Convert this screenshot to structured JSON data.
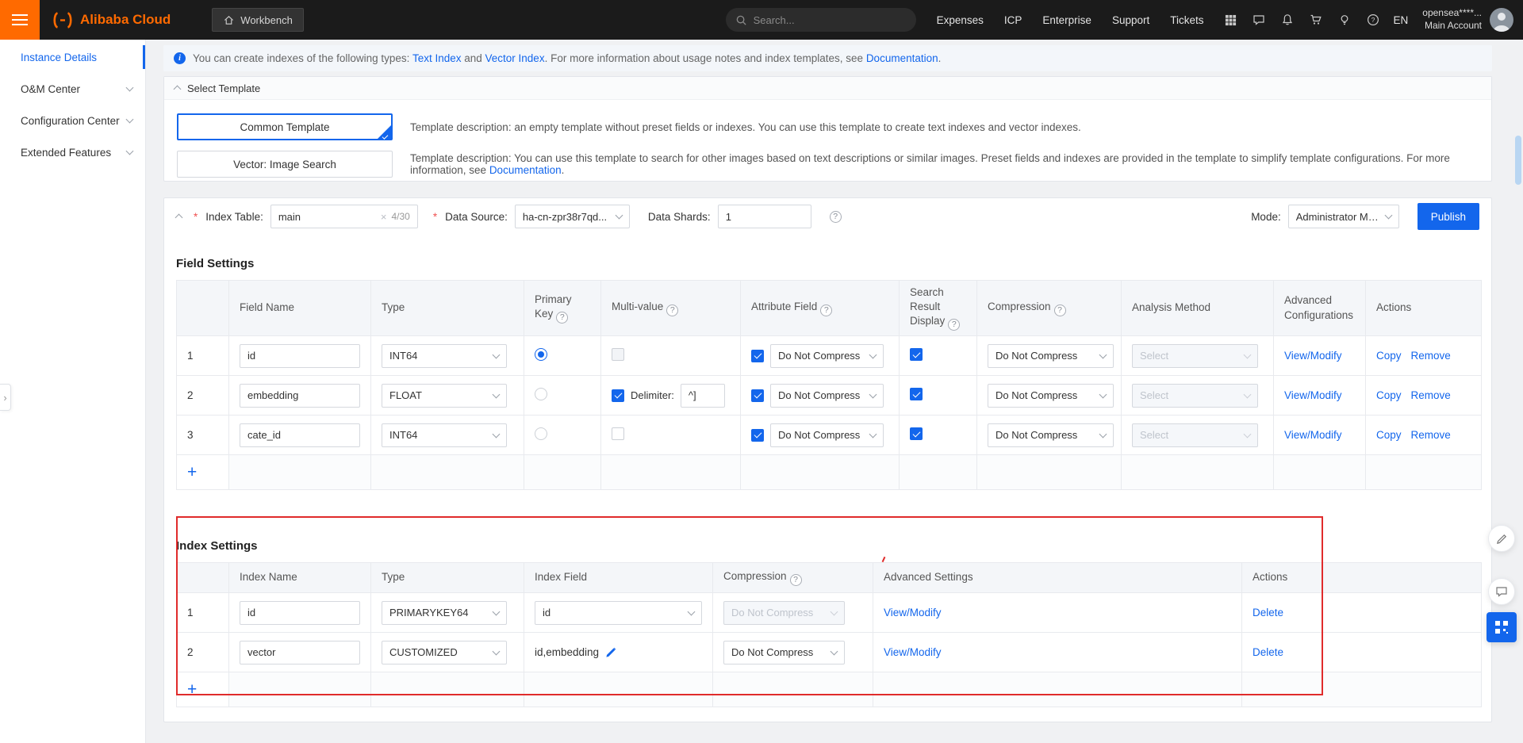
{
  "header": {
    "brand": "Alibaba Cloud",
    "workbench_label": "Workbench",
    "search_placeholder": "Search...",
    "nav_items": {
      "expenses": "Expenses",
      "icp": "ICP",
      "enterprise": "Enterprise",
      "support": "Support",
      "tickets": "Tickets"
    },
    "language": "EN",
    "account_name": "opensea****...",
    "account_type": "Main Account"
  },
  "sidebar": {
    "items": [
      {
        "label": "Instance Details",
        "active": true
      },
      {
        "label": "O&M Center",
        "active": false
      },
      {
        "label": "Configuration Center",
        "active": false
      },
      {
        "label": "Extended Features",
        "active": false
      }
    ]
  },
  "banner": {
    "part1": "You can create indexes of the following types: ",
    "link1": "Text Index",
    "part2": " and ",
    "link2": "Vector Index",
    "part3": ". For more information about usage notes and index templates, see ",
    "link3": "Documentation",
    "part4": "."
  },
  "template_section": {
    "title": "Select Template",
    "option1_label": "Common Template",
    "option1_selected": true,
    "option1_desc": "Template description: an empty template without preset fields or indexes. You can use this template to create text indexes and vector indexes.",
    "option2_label": "Vector: Image Search",
    "option2_selected": false,
    "option2_desc": "Template description: You can use this template to search for other images based on text descriptions or similar images. Preset fields and indexes are provided in the template to simplify template configurations. For more information, see ",
    "option2_desc_link": "Documentation",
    "option2_desc_end": "."
  },
  "config": {
    "index_table_label": "Index Table:",
    "index_table_value": "main",
    "index_table_count": "4/30",
    "data_source_label": "Data Source:",
    "data_source_value": "ha-cn-zpr38r7qd...",
    "data_shards_label": "Data Shards:",
    "data_shards_value": "1",
    "mode_label": "Mode:",
    "mode_value": "Administrator Mo...",
    "publish_label": "Publish"
  },
  "labels": {
    "do_not_compress": "Do Not Compress",
    "select_placeholder": "Select",
    "view_modify": "View/Modify",
    "copy": "Copy",
    "remove": "Remove",
    "delete": "Delete",
    "delimiter": "Delimiter:",
    "required_mark": "*"
  },
  "icons": {
    "question_mark": "?",
    "info": "i",
    "clear": "×",
    "add": "+",
    "expander": "›"
  },
  "field_settings": {
    "title": "Field Settings",
    "col_field_name": "Field Name",
    "col_type": "Type",
    "col_primary_key": "Primary Key",
    "col_multi_value": "Multi-value",
    "col_attribute_field": "Attribute Field",
    "col_search_result": "Search Result Display",
    "col_compression": "Compression",
    "col_analysis_method": "Analysis Method",
    "col_advanced": "Advanced Configurations",
    "col_actions": "Actions",
    "rows": [
      {
        "num": "1",
        "name": "id",
        "type": "INT64",
        "primary_key": true,
        "multi_value": false,
        "attribute_field": true,
        "search_result_display": true,
        "compression": "Do Not Compress",
        "analysis_method": "Select"
      },
      {
        "num": "2",
        "name": "embedding",
        "type": "FLOAT",
        "primary_key": false,
        "multi_value": true,
        "delimiter_value": "^]",
        "attribute_field": true,
        "search_result_display": true,
        "compression": "Do Not Compress",
        "analysis_method": "Select"
      },
      {
        "num": "3",
        "name": "cate_id",
        "type": "INT64",
        "primary_key": false,
        "multi_value": false,
        "attribute_field": true,
        "search_result_display": true,
        "compression": "Do Not Compress",
        "analysis_method": "Select"
      }
    ]
  },
  "index_settings": {
    "title": "Index Settings",
    "col_index_name": "Index Name",
    "col_type": "Type",
    "col_index_field": "Index Field",
    "col_compression": "Compression",
    "col_advanced": "Advanced Settings",
    "col_actions": "Actions",
    "rows": [
      {
        "num": "1",
        "name": "id",
        "type": "PRIMARYKEY64",
        "index_field": "id",
        "compression_disabled": true
      },
      {
        "num": "2",
        "name": "vector",
        "type": "CUSTOMIZED",
        "index_field": "id,embedding",
        "compression_disabled": false
      }
    ]
  }
}
